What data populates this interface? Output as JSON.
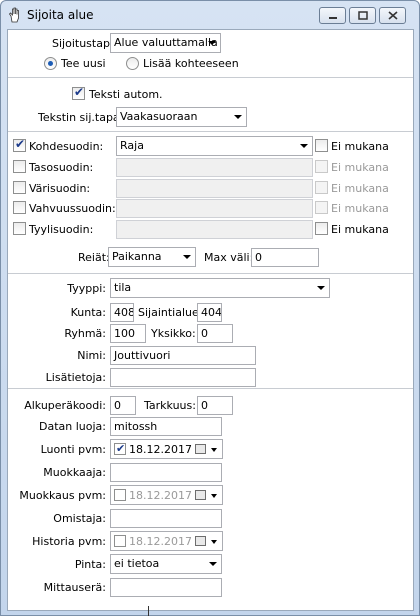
{
  "window": {
    "title": "Sijoita alue"
  },
  "placement": {
    "method_label": "Sijoitustapa",
    "method_value": "Alue valuuttamalla",
    "radio_new": "Tee uusi",
    "radio_add": "Lisää kohteeseen"
  },
  "text": {
    "auto_label": "Teksti autom.",
    "placement_label": "Tekstin sij.tapa",
    "placement_value": "Vaakasuoraan"
  },
  "filters": {
    "excluded_label": "Ei mukana",
    "rows": [
      {
        "label": "Kohdesuodin:",
        "value": "Raja"
      },
      {
        "label": "Tasosuodin:",
        "value": ""
      },
      {
        "label": "Värisuodin:",
        "value": ""
      },
      {
        "label": "Vahvuussuodin:",
        "value": ""
      },
      {
        "label": "Tyylisuodin:",
        "value": ""
      }
    ],
    "holes_label": "Reiät:",
    "holes_value": "Paikanna",
    "max_gap_label": "Max väli:",
    "max_gap_value": "0"
  },
  "attributes": {
    "type_label": "Tyyppi:",
    "type_value": "tila",
    "municipality_label": "Kunta:",
    "municipality_value": "408",
    "location_label": "Sijaintialue:",
    "location_value": "404",
    "group_label": "Ryhmä:",
    "group_value": "100",
    "unit_label": "Yksikko:",
    "unit_value": "0",
    "name_label": "Nimi:",
    "name_value": "Jouttivuori",
    "extra_label": "Lisätietoja:",
    "extra_value": ""
  },
  "metadata": {
    "origin_label": "Alkuperäkoodi:",
    "origin_value": "0",
    "accuracy_label": "Tarkkuus:",
    "accuracy_value": "0",
    "creator_label": "Datan luoja:",
    "creator_value": "mitossh",
    "created_label": "Luonti pvm:",
    "created_value": "18.12.2017",
    "editor_label": "Muokkaaja:",
    "editor_value": "",
    "modified_label": "Muokkaus pvm:",
    "modified_value": "18.12.2017",
    "owner_label": "Omistaja:",
    "owner_value": "",
    "history_label": "Historia pvm:",
    "history_value": "18.12.2017",
    "surface_label": "Pinta:",
    "surface_value": "ei tietoa",
    "batch_label": "Mittauserä:",
    "batch_value": ""
  }
}
